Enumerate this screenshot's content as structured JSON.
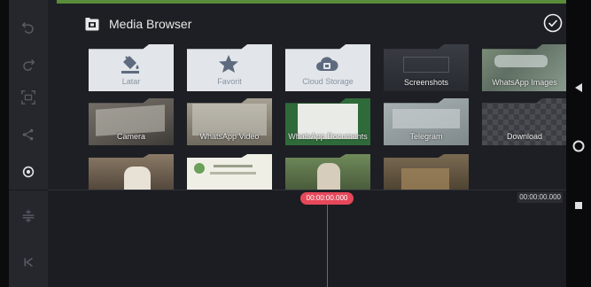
{
  "app": {
    "header": {
      "title": "Media Browser",
      "title_icon": "media-browser-icon",
      "done_icon": "check-circle-icon"
    }
  },
  "toolbar": {
    "items": [
      {
        "name": "undo",
        "icon": "undo-icon"
      },
      {
        "name": "redo",
        "icon": "redo-icon"
      },
      {
        "name": "screenshot",
        "icon": "screen-capture-icon"
      },
      {
        "name": "share",
        "icon": "share-icon"
      },
      {
        "name": "settings",
        "icon": "settings-icon",
        "active": true
      },
      {
        "name": "layers",
        "icon": "layers-icon"
      },
      {
        "name": "jump-to-start",
        "icon": "skip-start-icon"
      }
    ]
  },
  "media": {
    "row1": [
      {
        "label": "Latar",
        "kind": "folder",
        "icon": "paint-bucket-icon"
      },
      {
        "label": "Favorit",
        "kind": "folder",
        "icon": "star-icon"
      },
      {
        "label": "Cloud Storage",
        "kind": "folder",
        "icon": "cloud-storage-icon"
      },
      {
        "label": "Screenshots",
        "kind": "album"
      },
      {
        "label": "WhatsApp Images",
        "kind": "album"
      }
    ],
    "row2": [
      {
        "label": "Camera",
        "kind": "album"
      },
      {
        "label": "WhatsApp Video",
        "kind": "album"
      },
      {
        "label": "WhatsApp Documents",
        "kind": "album"
      },
      {
        "label": "Telegram",
        "kind": "album"
      },
      {
        "label": "Download",
        "kind": "album"
      }
    ],
    "row3_count": 4
  },
  "timeline": {
    "current_time": "00:00:00.000",
    "total_time": "00:00:00.000"
  },
  "system_nav": {
    "back_icon": "back-triangle-icon",
    "home_icon": "home-circle-icon",
    "recents_icon": "recents-square-icon"
  },
  "colors": {
    "accent": "#e6485a",
    "folder_bg": "#e2e6ea",
    "folder_icon": "#5e6b7e",
    "panel_bg": "#1e1f24"
  }
}
